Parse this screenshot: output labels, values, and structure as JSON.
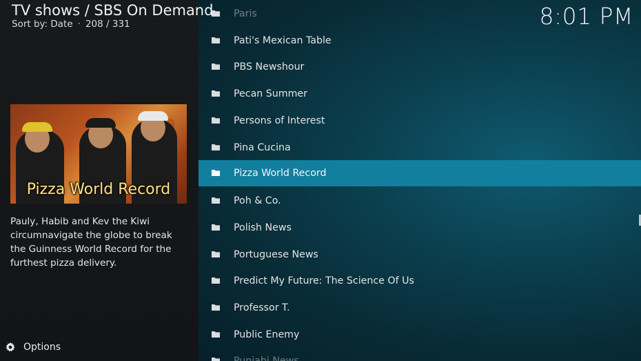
{
  "header": {
    "title": "TV shows / SBS On Demand",
    "sort_label": "Sort by: Date",
    "separator": "·",
    "position": "208 / 331"
  },
  "clock": "8:01 PM",
  "selected_show": {
    "poster_title": "Pizza World Record",
    "plot": "Pauly, Habib and Kev the Kiwi circumnavigate the globe to break the Guinness World Record for the furthest pizza delivery."
  },
  "footer": {
    "options_label": "Options",
    "options_icon": "gear-icon"
  },
  "list": {
    "item_icon": "folder-icon",
    "selected_color": "#127f9e",
    "items": [
      {
        "label": "Paris"
      },
      {
        "label": "Pati's Mexican Table"
      },
      {
        "label": "PBS Newshour"
      },
      {
        "label": "Pecan Summer"
      },
      {
        "label": "Persons of Interest"
      },
      {
        "label": "Pina Cucina"
      },
      {
        "label": "Pizza World Record"
      },
      {
        "label": "Poh & Co."
      },
      {
        "label": "Polish News"
      },
      {
        "label": "Portuguese News"
      },
      {
        "label": "Predict My Future: The Science Of Us"
      },
      {
        "label": "Professor T."
      },
      {
        "label": "Public Enemy"
      },
      {
        "label": "Punjabi News"
      }
    ]
  }
}
